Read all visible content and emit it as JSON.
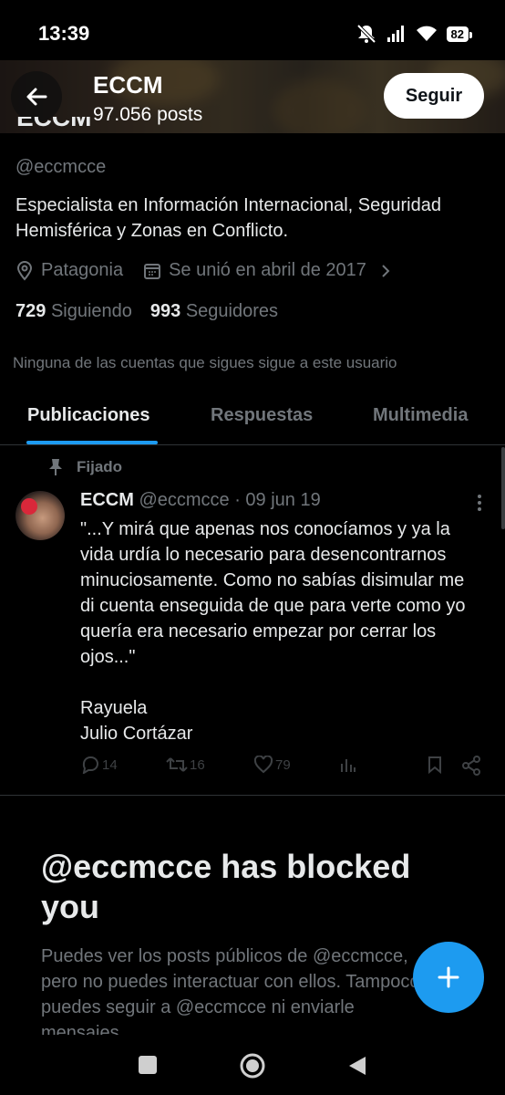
{
  "status": {
    "time": "13:39",
    "battery": "82"
  },
  "header": {
    "title": "ECCM",
    "posts": "97.056 posts",
    "follow_label": "Seguir"
  },
  "profile": {
    "name": "ECCM",
    "handle": "@eccmcce",
    "bio": "Especialista en Información Internacional, Seguridad Hemisférica y Zonas en Conflicto.",
    "location": "Patagonia",
    "joined": "Se unió en abril de 2017",
    "following_count": "729",
    "following_label": "Siguiendo",
    "followers_count": "993",
    "followers_label": "Seguidores",
    "no_common": "Ninguna de las cuentas que sigues sigue a este usuario"
  },
  "tabs": [
    {
      "label": "Publicaciones",
      "active": true
    },
    {
      "label": "Respuestas",
      "active": false
    },
    {
      "label": "Multimedia",
      "active": false
    }
  ],
  "post": {
    "pinned_label": "Fijado",
    "author": "ECCM",
    "handle_date": "@eccmcce · 09 jun 19",
    "text": "\"...Y mirá que apenas nos conocíamos y ya la vida urdía lo necesario para desencontrarnos minuciosamente. Como no sabías disimular me di cuenta enseguida de que para verte como yo quería era necesario empezar por cerrar los ojos...\"\n\nRayuela\nJulio Cortázar",
    "replies": "14",
    "reposts": "16",
    "likes": "79"
  },
  "blocked": {
    "title": "@eccmcce has blocked you",
    "text": "Puedes ver los posts públicos de @eccmcce, pero no puedes interactuar con ellos. Tampoco puedes seguir a @eccmcce ni enviarle mensajes."
  },
  "colors": {
    "accent": "#1d9bf0",
    "background": "#000000",
    "muted": "#71767b"
  }
}
